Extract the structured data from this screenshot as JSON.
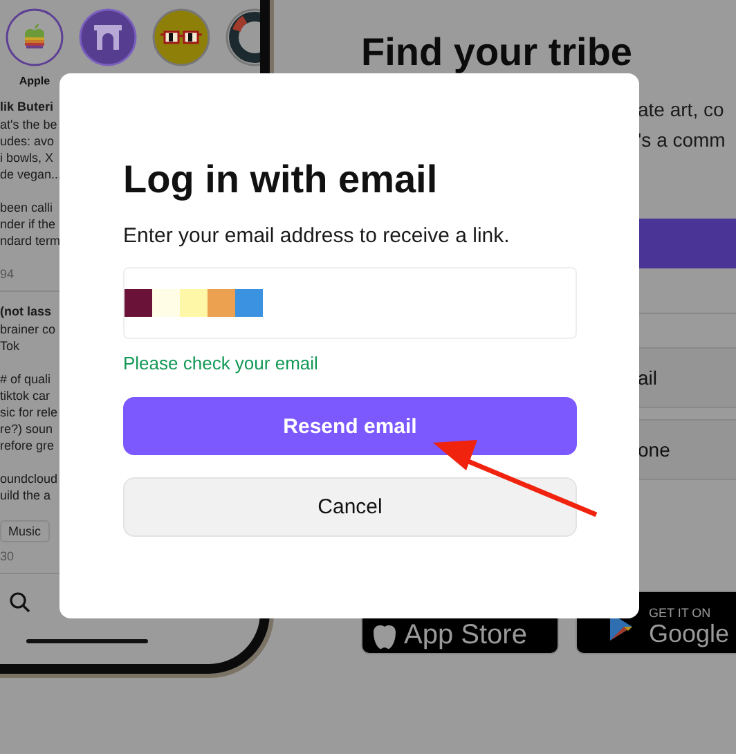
{
  "phone": {
    "app_icons": [
      {
        "kind": "apple",
        "label": "Apple"
      },
      {
        "kind": "arch"
      },
      {
        "kind": "glasses"
      },
      {
        "kind": "ring"
      }
    ],
    "posts": [
      {
        "author": "lik Buteri",
        "paragraphs": [
          [
            "at's the be",
            "udes: avo",
            "i bowls, X",
            "de vegan..."
          ],
          [
            "been calli",
            "nder if the",
            "ndard term"
          ]
        ],
        "count": "94"
      },
      {
        "author": "(not lass",
        "paragraphs": [
          [
            "brainer co",
            "Tok"
          ],
          [
            "# of quali",
            "tiktok car",
            "sic for rele",
            "re?) soun",
            "refore gre"
          ],
          [
            "oundcloud",
            "uild the a"
          ]
        ],
        "tag": "Music",
        "count": "30"
      }
    ]
  },
  "landing": {
    "title": "Find your tribe",
    "intro_lines": [
      "ate art, co",
      "'s a comm"
    ],
    "options": [
      "ail",
      "one"
    ],
    "store_badges": [
      {
        "kind": "apple",
        "text": "App Store"
      },
      {
        "kind": "google",
        "small": "GET IT ON",
        "text": "Google"
      }
    ]
  },
  "modal": {
    "title": "Log in with email",
    "subtitle": "Enter your email address to receive a link.",
    "email_redacted": true,
    "message": "Please check your email",
    "primary_button": "Resend email",
    "secondary_button": "Cancel"
  }
}
